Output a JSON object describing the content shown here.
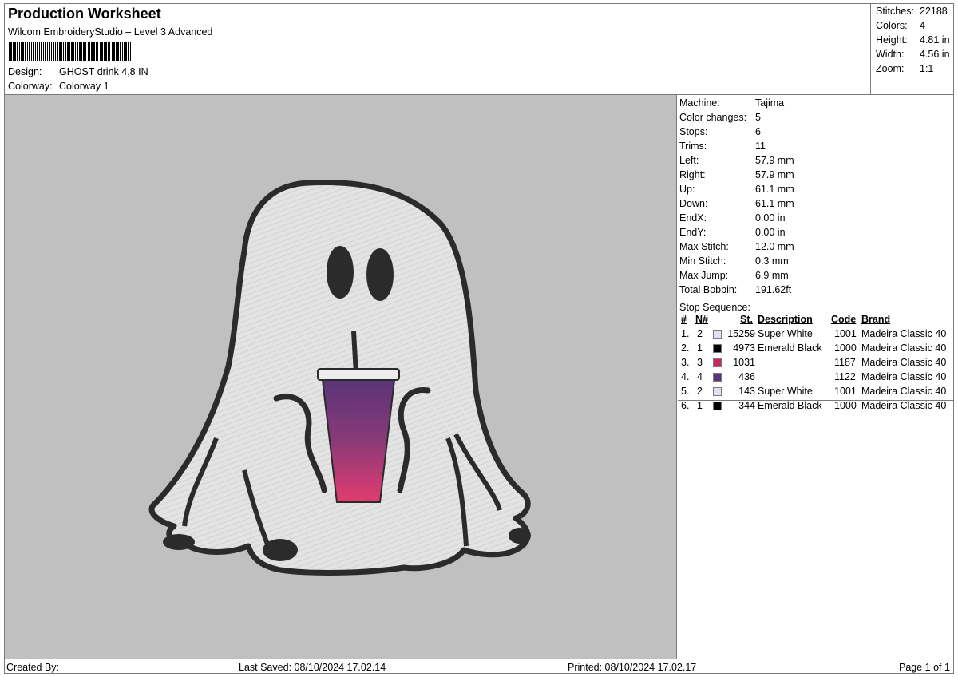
{
  "header": {
    "title": "Production Worksheet",
    "software": "Wilcom EmbroideryStudio – Level 3 Advanced",
    "design_label": "Design:",
    "design_value": "GHOST drink 4,8 IN",
    "colorway_label": "Colorway:",
    "colorway_value": "Colorway 1"
  },
  "summary": {
    "stitches_label": "Stitches:",
    "stitches": "22188",
    "colors_label": "Colors:",
    "colors": "4",
    "height_label": "Height:",
    "height": "4.81 in",
    "width_label": "Width:",
    "width": "4.56 in",
    "zoom_label": "Zoom:",
    "zoom": "1:1"
  },
  "machine": [
    {
      "label": "Machine:",
      "value": "Tajima"
    },
    {
      "label": "Color changes:",
      "value": "5"
    },
    {
      "label": "Stops:",
      "value": "6"
    },
    {
      "label": "Trims:",
      "value": "11"
    },
    {
      "label": "Left:",
      "value": "57.9 mm"
    },
    {
      "label": "Right:",
      "value": "57.9 mm"
    },
    {
      "label": "Up:",
      "value": "61.1 mm"
    },
    {
      "label": "Down:",
      "value": "61.1 mm"
    },
    {
      "label": "EndX:",
      "value": "0.00 in"
    },
    {
      "label": "EndY:",
      "value": "0.00 in"
    },
    {
      "label": "Max Stitch:",
      "value": "12.0 mm"
    },
    {
      "label": "Min Stitch:",
      "value": "0.3 mm"
    },
    {
      "label": "Max Jump:",
      "value": "6.9 mm"
    },
    {
      "label": "Total Bobbin:",
      "value": "191.62ft"
    }
  ],
  "stop_sequence": {
    "title": "Stop Sequence:",
    "headers": {
      "num": "#",
      "n": "N#",
      "st": "St.",
      "desc": "Description",
      "code": "Code",
      "brand": "Brand"
    },
    "rows": [
      {
        "num": "1.",
        "n": "2",
        "color": "#dfe2f5",
        "st": "15259",
        "desc": "Super White",
        "code": "1001",
        "brand": "Madeira Classic 40"
      },
      {
        "num": "2.",
        "n": "1",
        "color": "#000000",
        "st": "4973",
        "desc": "Emerald Black",
        "code": "1000",
        "brand": "Madeira Classic 40"
      },
      {
        "num": "3.",
        "n": "3",
        "color": "#c8285a",
        "st": "1031",
        "desc": "",
        "code": "1187",
        "brand": "Madeira Classic 40"
      },
      {
        "num": "4.",
        "n": "4",
        "color": "#5a3478",
        "st": "436",
        "desc": "",
        "code": "1122",
        "brand": "Madeira Classic 40"
      },
      {
        "num": "5.",
        "n": "2",
        "color": "#dfe2f5",
        "st": "143",
        "desc": "Super White",
        "code": "1001",
        "brand": "Madeira Classic 40"
      },
      {
        "num": "6.",
        "n": "1",
        "color": "#000000",
        "st": "344",
        "desc": "Emerald Black",
        "code": "1000",
        "brand": "Madeira Classic 40"
      }
    ]
  },
  "footer": {
    "created_by": "Created By:",
    "last_saved": "Last Saved: 08/10/2024 17.02.14",
    "printed": "Printed: 08/10/2024 17.02.17",
    "page": "Page 1 of 1"
  }
}
